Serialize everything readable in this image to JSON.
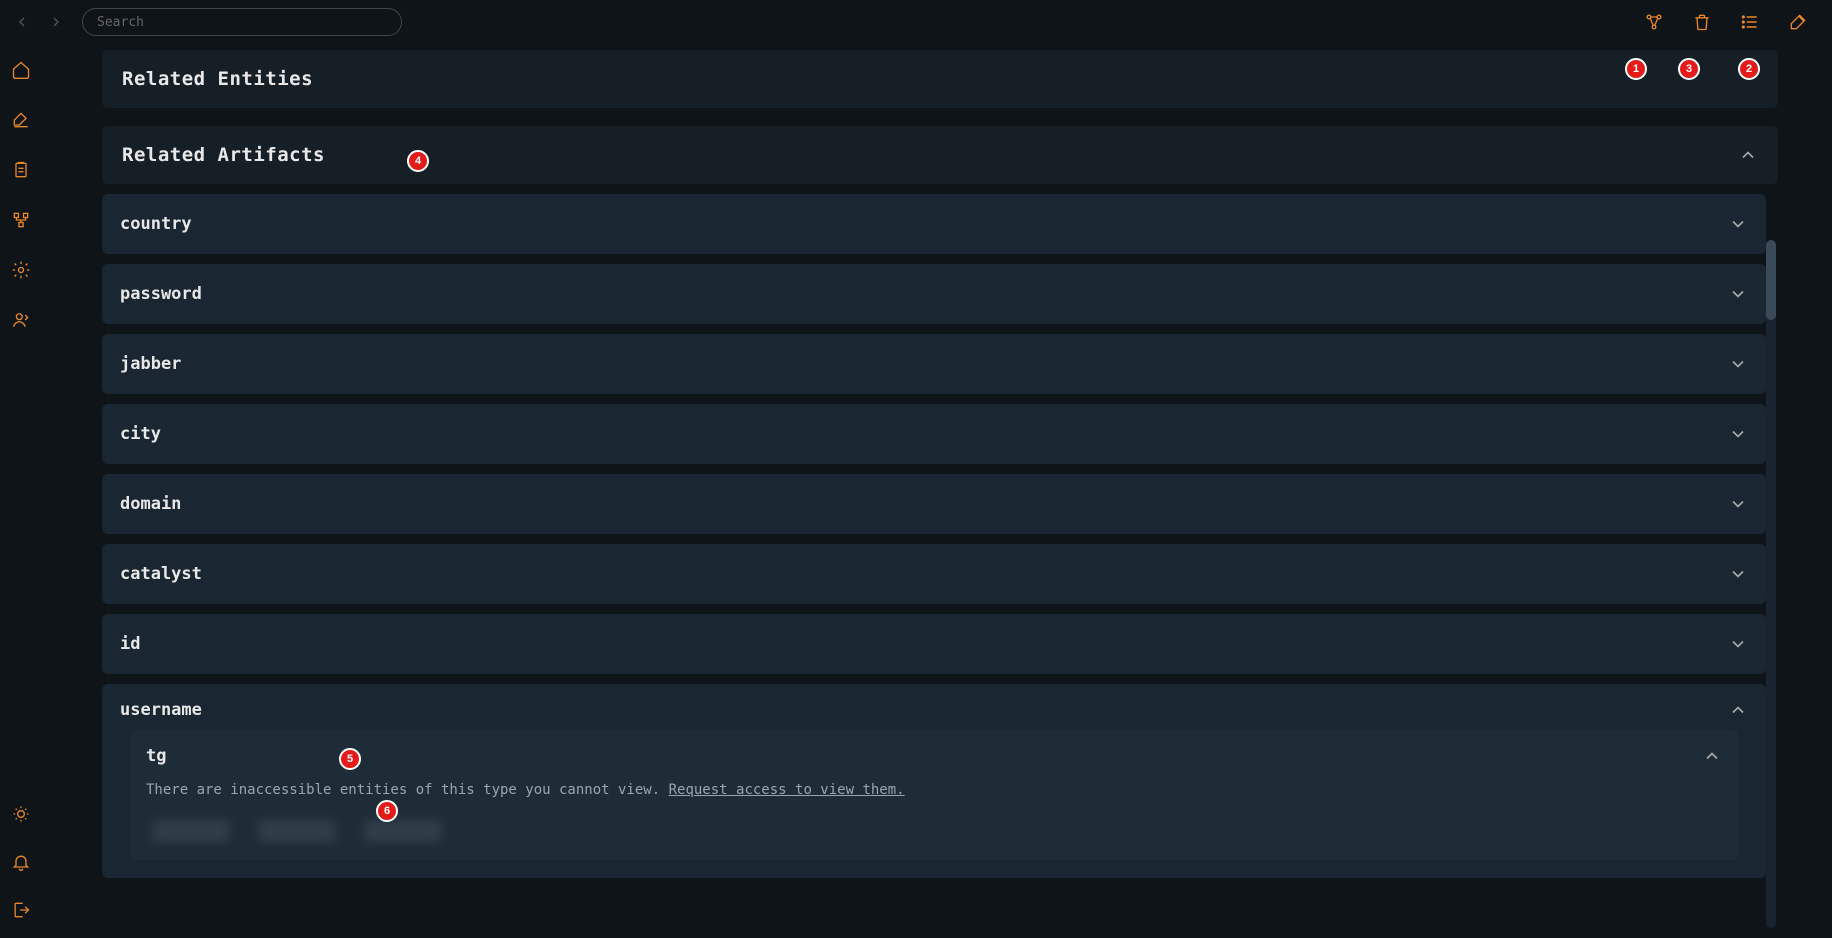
{
  "search": {
    "placeholder": "Search"
  },
  "topActions": {
    "graph": "graph-icon",
    "trash": "trash-icon",
    "list": "list-icon",
    "pen": "pen-icon"
  },
  "sections": {
    "relatedEntities": {
      "title": "Related Entities"
    },
    "relatedArtifacts": {
      "title": "Related Artifacts"
    }
  },
  "artifacts": [
    {
      "label": "country",
      "expanded": false
    },
    {
      "label": "password",
      "expanded": false
    },
    {
      "label": "jabber",
      "expanded": false
    },
    {
      "label": "city",
      "expanded": false
    },
    {
      "label": "domain",
      "expanded": false
    },
    {
      "label": "catalyst",
      "expanded": false
    },
    {
      "label": "id",
      "expanded": false
    },
    {
      "label": "username",
      "expanded": true
    }
  ],
  "usernameSub": {
    "label": "tg",
    "inaccessibleText": "There are inaccessible entities of this type you cannot view. ",
    "requestLink": "Request access to view them."
  },
  "markers": {
    "m1": "1",
    "m2": "2",
    "m3": "3",
    "m4": "4",
    "m5": "5",
    "m6": "6"
  }
}
